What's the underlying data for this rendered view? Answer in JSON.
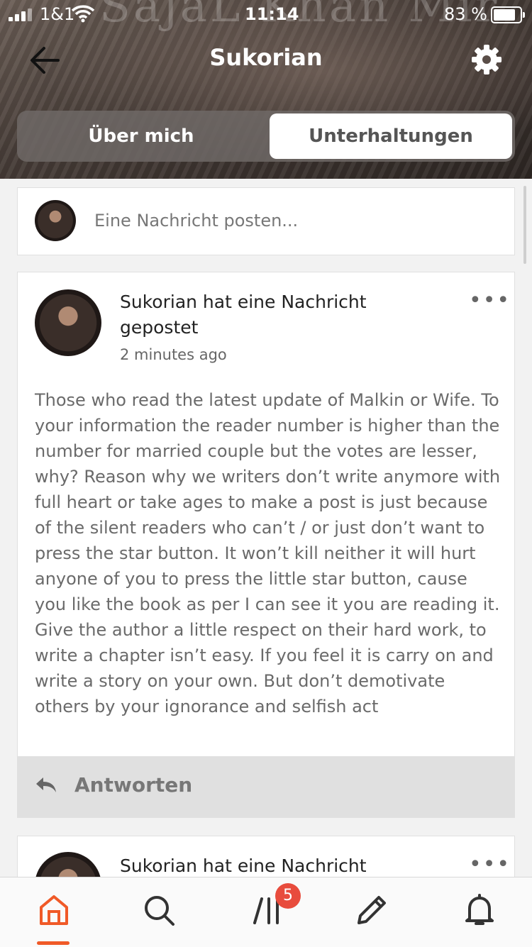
{
  "status": {
    "carrier": "1&1",
    "time": "11:14",
    "battery": "83 %"
  },
  "header": {
    "watermark": "SajaL Khan Mir",
    "title": "Sukorian",
    "tabs": [
      {
        "label": "Über mich",
        "active": false
      },
      {
        "label": "Unterhaltungen",
        "active": true
      }
    ]
  },
  "compose": {
    "placeholder": "Eine Nachricht posten..."
  },
  "posts": [
    {
      "header": "Sukorian hat eine Nachricht gepostet",
      "time": "2 minutes ago",
      "body": "Those who read the latest update of Malkin or Wife. To your information the reader number is higher than the number for married couple but the votes are lesser, why? Reason why we writers don’t write anymore with full heart or take ages to make a post is just because of the silent readers who can’t / or just don’t want to press the star button. It won’t kill neither it will hurt anyone of you to press the little star button, cause you like the book as per I can see it you are reading it. Give the author a little respect on their hard work, to write a chapter isn’t easy. If you feel it is carry on and write a story on your own. But don’t demotivate others by your ignorance and selfish act",
      "reply_label": "Antworten",
      "more": "•••"
    },
    {
      "header": "Sukorian hat eine Nachricht",
      "more": "•••"
    }
  ],
  "tabbar": {
    "items": [
      {
        "icon": "home-icon",
        "active": true
      },
      {
        "icon": "search-icon",
        "active": false
      },
      {
        "icon": "library-icon",
        "active": false
      },
      {
        "icon": "pencil-icon",
        "active": false
      },
      {
        "icon": "bell-icon",
        "active": false
      }
    ],
    "library_badge": "5",
    "accent_color": "#f05a28"
  }
}
